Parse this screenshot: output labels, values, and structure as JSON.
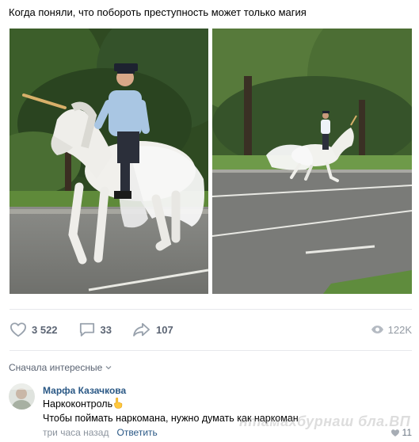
{
  "post": {
    "text": "Когда поняли, что побороть преступность может только магия"
  },
  "stats": {
    "likes": "3 522",
    "comments": "33",
    "shares": "107",
    "views": "122K"
  },
  "comments_section": {
    "sort_label": "Сначала интересные",
    "items": [
      {
        "author": "Марфа Казачкова",
        "line1": "Наркоконтроль",
        "line2": "Чтобы поймать наркомана, нужно думать как наркоман",
        "time": "три часа назад",
        "reply_label": "Ответить",
        "likes": "11"
      }
    ]
  },
  "watermark": "нтамахбурнаш бла.ВП",
  "icons": {
    "like": "heart-outline-icon",
    "comment": "speech-bubble-icon",
    "share": "share-arrow-icon",
    "views": "eye-icon",
    "sort": "chevron-down-icon",
    "emoji": "raised-index-finger-icon",
    "comment_like": "heart-filled-icon"
  },
  "colors": {
    "link": "#2a5885",
    "counter": "#5b6473",
    "muted": "#939aa3"
  }
}
